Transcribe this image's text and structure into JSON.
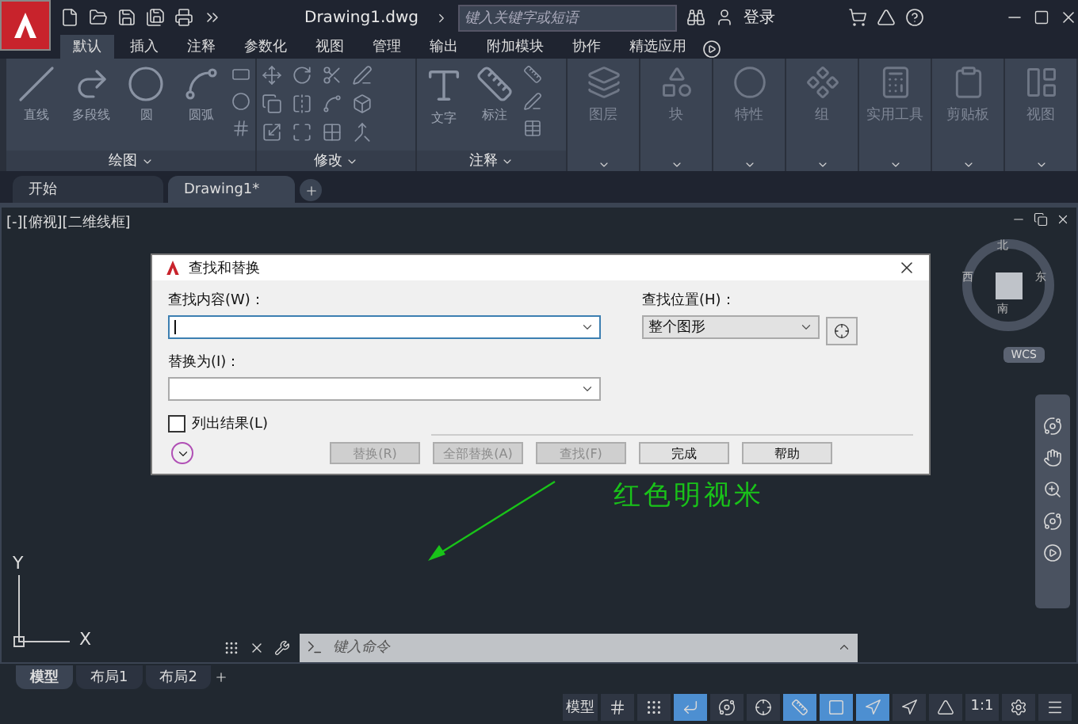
{
  "app": {
    "file_name": "Drawing1.dwg",
    "search": {
      "placeholder": "键入关键字或短语"
    },
    "login": "登录"
  },
  "ribbon_tabs": [
    {
      "label": "默认",
      "selected": true
    },
    {
      "label": "插入",
      "selected": false
    },
    {
      "label": "注释",
      "selected": false
    },
    {
      "label": "参数化",
      "selected": false
    },
    {
      "label": "视图",
      "selected": false
    },
    {
      "label": "管理",
      "selected": false
    },
    {
      "label": "输出",
      "selected": false
    },
    {
      "label": "附加模块",
      "selected": false
    },
    {
      "label": "协作",
      "selected": false
    },
    {
      "label": "精选应用",
      "selected": false
    }
  ],
  "panels": [
    {
      "title": "绘图",
      "kind": "draw",
      "tools": [
        "直线",
        "多段线",
        "圆",
        "圆弧"
      ]
    },
    {
      "title": "修改",
      "kind": "modify"
    },
    {
      "title": "注释",
      "kind": "annotate",
      "tools": [
        "文字",
        "标注"
      ]
    },
    {
      "title": "图层",
      "kind": "collapsed"
    },
    {
      "title": "块",
      "kind": "collapsed"
    },
    {
      "title": "特性",
      "kind": "collapsed"
    },
    {
      "title": "组",
      "kind": "collapsed"
    },
    {
      "title": "实用工具",
      "kind": "collapsed"
    },
    {
      "title": "剪贴板",
      "kind": "collapsed"
    },
    {
      "title": "视图",
      "kind": "collapsed"
    }
  ],
  "file_tabs": [
    {
      "label": "开始",
      "selected": false
    },
    {
      "label": "Drawing1*",
      "selected": true
    }
  ],
  "viewport": {
    "label": "[-][俯视][二维线框]",
    "compass": {
      "north": "北",
      "west": "西",
      "east": "东",
      "south": "南"
    },
    "ucs_name": "WCS",
    "axis_x": "X",
    "axis_y": "Y",
    "annotation": "红色明视米"
  },
  "dialog": {
    "title": "查找和替换",
    "find_label": "查找内容(W)：",
    "replace_label": "替换为(I)：",
    "location_label": "查找位置(H)：",
    "location_value": "整个图形",
    "list_results": {
      "label": "列出结果(L)",
      "checked": false
    },
    "buttons": [
      {
        "label": "替换(R)",
        "disabled": true
      },
      {
        "label": "全部替换(A)",
        "disabled": true
      },
      {
        "label": "查找(F)",
        "disabled": true
      },
      {
        "label": "完成",
        "disabled": false
      },
      {
        "label": "帮助",
        "disabled": false
      }
    ]
  },
  "command_line": {
    "placeholder": "键入命令"
  },
  "layout_tabs": [
    {
      "label": "模型",
      "selected": true
    },
    {
      "label": "布局1",
      "selected": false
    },
    {
      "label": "布局2",
      "selected": false
    }
  ],
  "status_bar": {
    "model": "模型",
    "scale": "1:1",
    "toggles": [
      {
        "on": false
      },
      {
        "on": false
      },
      {
        "on": true
      },
      {
        "on": false
      },
      {
        "on": false
      },
      {
        "on": true
      },
      {
        "on": true
      },
      {
        "on": true
      },
      {
        "on": false
      },
      {
        "on": false
      }
    ]
  }
}
